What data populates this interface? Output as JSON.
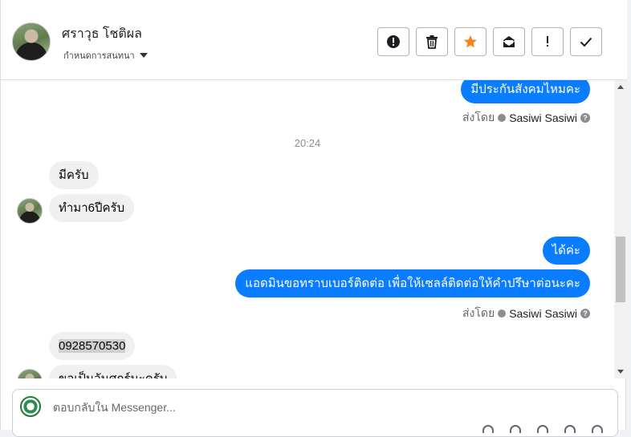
{
  "header": {
    "contact_name": "ศราวุธ โชติผล",
    "conversation_settings": "กำหนดการสนทนา",
    "toolbar": [
      {
        "name": "report-button",
        "icon": "exclamation-circle-icon"
      },
      {
        "name": "delete-button",
        "icon": "trash-icon"
      },
      {
        "name": "star-button",
        "icon": "star-icon",
        "color": "#f5821f"
      },
      {
        "name": "mark-unread-button",
        "icon": "envelope-icon"
      },
      {
        "name": "important-button",
        "icon": "exclamation-icon"
      },
      {
        "name": "done-button",
        "icon": "check-icon"
      }
    ]
  },
  "messages": {
    "out_1": "มีประกันสังคมไหมคะ",
    "sent_by_label": "ส่งโดย",
    "sender_name": "Sasiwi Sasiwi",
    "timestamp": "20:24",
    "in_1": "มีครับ",
    "in_2": "ทำมา6ปีครับ",
    "out_2": "ได้ค่ะ",
    "out_3": "แอดมินขอทราบเบอร์ติดต่อ เพื่อให้เซลล์ติดต่อให้คำปรึษาต่อนะคะ",
    "in_3": "0928570530",
    "in_4": "ขอเป็นวันศุกร์นะครับ"
  },
  "composer": {
    "placeholder": "ตอบกลับใน Messenger..."
  },
  "colors": {
    "outgoing_bubble": "#0a7cff",
    "incoming_bubble": "#f0f0f0",
    "star": "#f5821f"
  }
}
